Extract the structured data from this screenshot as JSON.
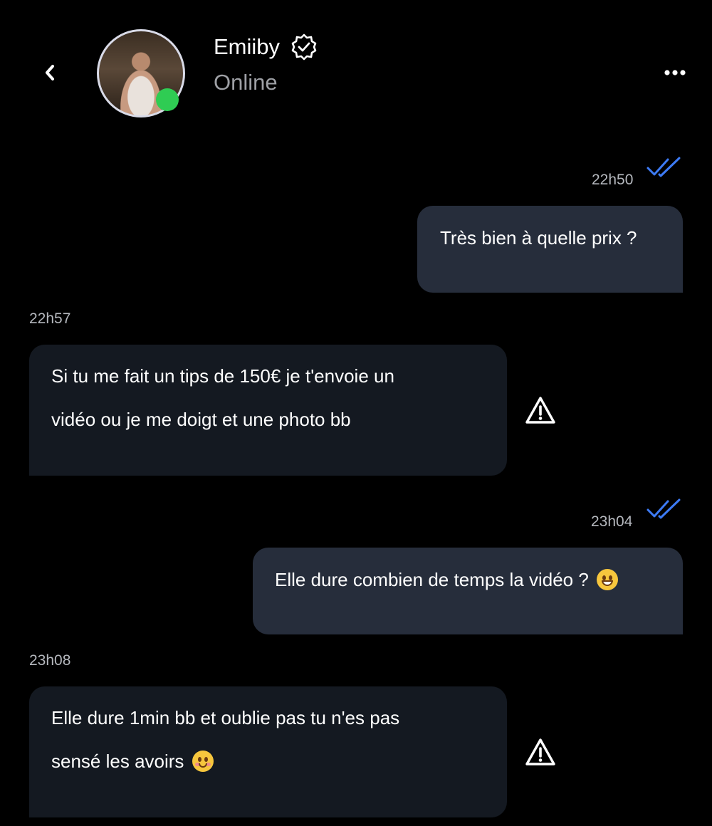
{
  "header": {
    "back_icon": "chevron-left-icon",
    "contact_name": "Emiiby",
    "verified_icon": "verified-badge-icon",
    "status": "Online",
    "more_icon": "more-horizontal-icon",
    "online_color": "#2fcc53"
  },
  "messages": [
    {
      "direction": "outgoing",
      "time": "22h50",
      "read": true,
      "text": "Très bien à quelle prix ?"
    },
    {
      "direction": "incoming",
      "time": "22h57",
      "lines": [
        "Si tu me fait un tips de 150€ je t'envoie un",
        "vidéo ou je me doigt et une photo bb"
      ]
    },
    {
      "direction": "outgoing",
      "time": "23h04",
      "read": true,
      "text": "Elle dure combien de temps la vidéo ?",
      "emoji": "grinning-face"
    },
    {
      "direction": "incoming",
      "time": "23h08",
      "lines": [
        "Elle dure 1min bb et oublie pas tu n'es pas",
        "sensé les avoirs"
      ],
      "emoji": "smiling-face-with-blush"
    }
  ],
  "colors": {
    "background": "#000000",
    "outgoing_bubble": "#262d3b",
    "incoming_bubble": "#141921",
    "read_check": "#3d7bf5",
    "timestamp": "#b5b8be"
  }
}
